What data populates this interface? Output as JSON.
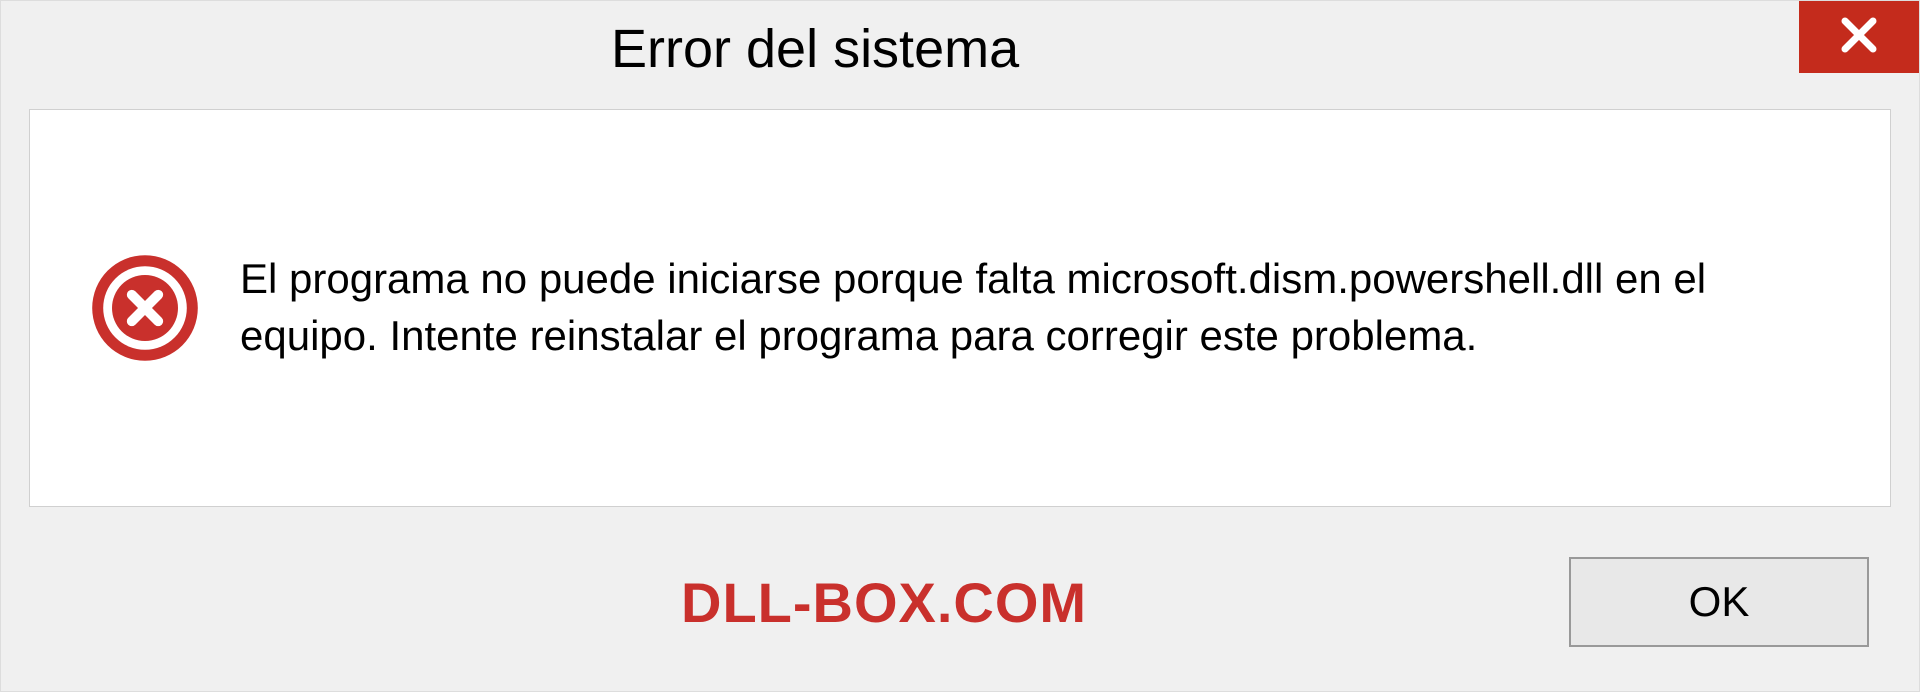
{
  "dialog": {
    "title": "Error del sistema",
    "message": "El programa no puede iniciarse porque falta microsoft.dism.powershell.dll en el equipo. Intente reinstalar el programa para corregir este problema.",
    "ok_label": "OK"
  },
  "watermark": "DLL-BOX.COM"
}
